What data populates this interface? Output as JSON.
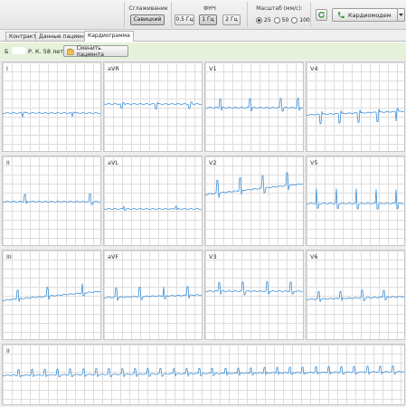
{
  "toolbar": {
    "smoothing": {
      "label": "Сглаживание",
      "button": "Савицкий"
    },
    "hpf": {
      "label": "ФНЧ",
      "options": [
        "0.5 Гц",
        "1 Гц",
        "2 Гц"
      ],
      "selected": "1 Гц"
    },
    "scale": {
      "label": "Масштаб (мм/с):",
      "options": [
        "25",
        "50",
        "100"
      ],
      "selected": "25"
    },
    "device_button": "Кардиомодем"
  },
  "tabs": [
    {
      "label": "Контракт",
      "active": false
    },
    {
      "label": "Данные пациента",
      "active": false
    },
    {
      "label": "Кардиограмма",
      "active": true
    }
  ],
  "patient": {
    "name_initial": "Б",
    "name_rest": "Р. К. 58 лет",
    "change_button": "Сменить пациента"
  },
  "leads": [
    "I",
    "aVR",
    "V1",
    "V4",
    "II",
    "aVL",
    "V2",
    "V5",
    "III",
    "aVF",
    "V3",
    "V6"
  ],
  "rhythm_lead": "II",
  "colors": {
    "trace": "#3d8fd6",
    "accent_green": "#2e8a2e",
    "patient_bar": "#e6f1da"
  },
  "icons": [
    "refresh-icon",
    "phone-icon",
    "dropdown-arrow-icon",
    "change-patient-icon"
  ]
}
